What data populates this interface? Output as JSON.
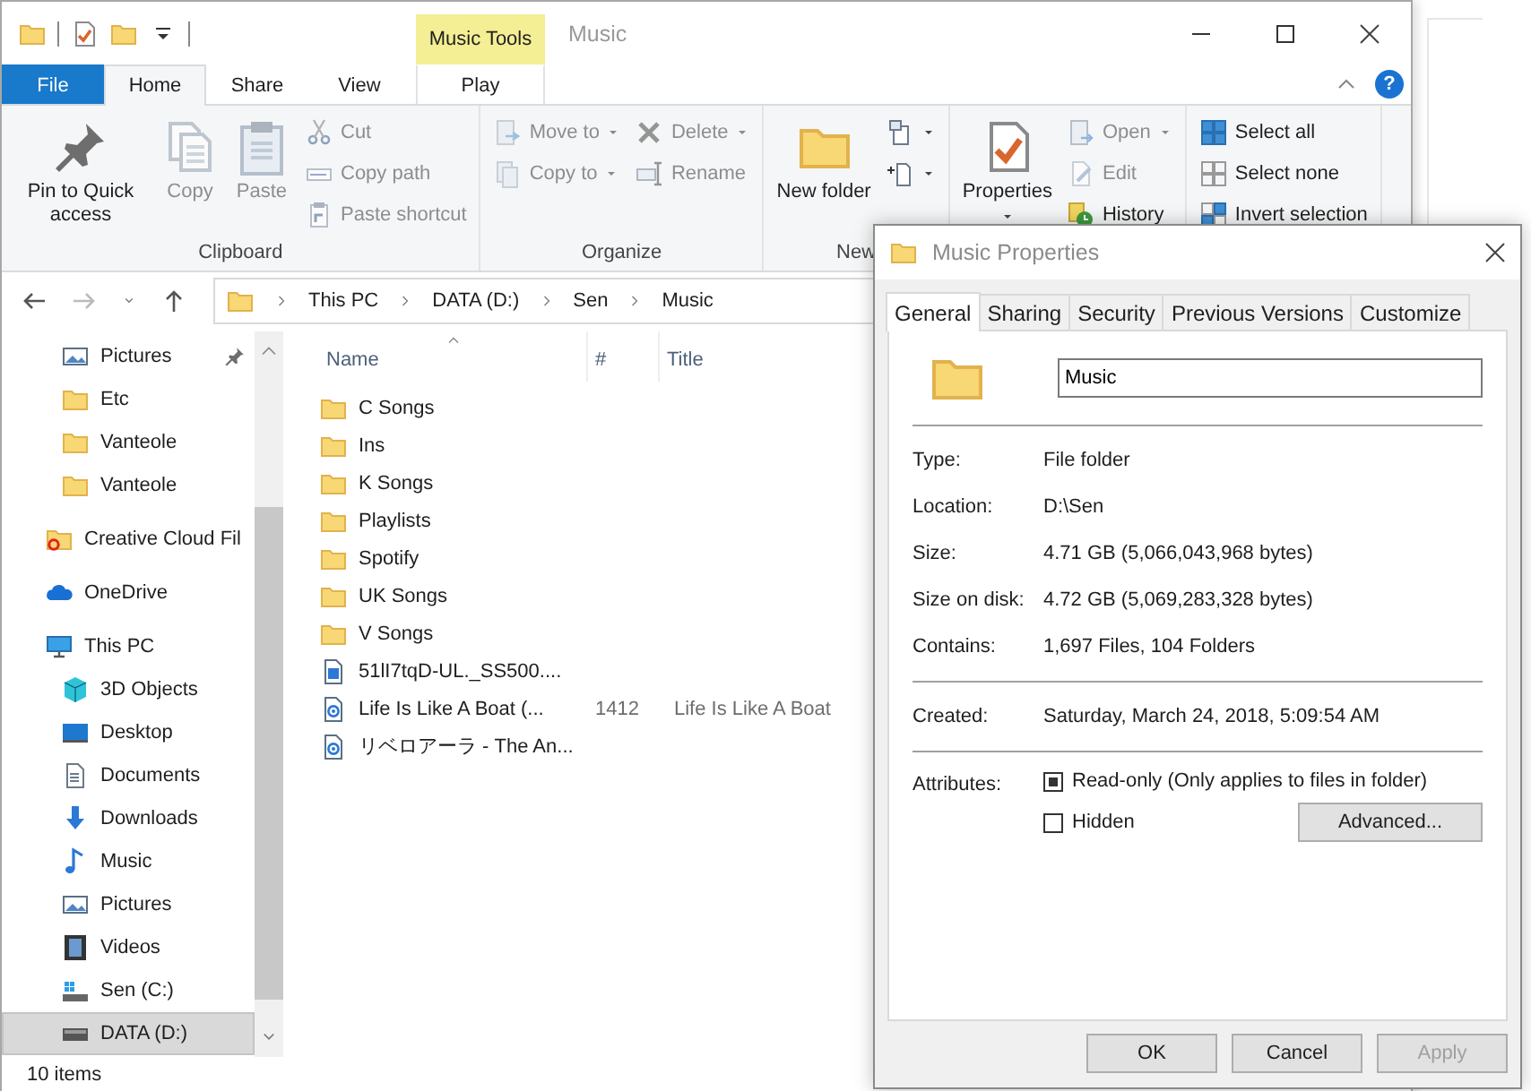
{
  "explorer": {
    "title": "Music",
    "contextual_tab": {
      "group": "Music Tools",
      "tab": {
        "label": "Play",
        "selected": false
      }
    },
    "ribbon_tabs": [
      {
        "label": "File",
        "kind": "file",
        "selected": false
      },
      {
        "label": "Home",
        "kind": "tab",
        "selected": true
      },
      {
        "label": "Share",
        "kind": "tab",
        "selected": false
      },
      {
        "label": "View",
        "kind": "tab",
        "selected": false
      }
    ],
    "help_button": "?",
    "ribbon_groups": [
      {
        "label": "Clipboard",
        "columns": [
          [
            {
              "label": "Pin to Quick access",
              "kind": "large",
              "disabled": false,
              "dropdown": false
            }
          ],
          [
            {
              "label": "Copy",
              "kind": "large",
              "disabled": true,
              "dropdown": false
            }
          ],
          [
            {
              "label": "Paste",
              "kind": "large",
              "disabled": true,
              "dropdown": false
            }
          ],
          [
            {
              "label": "Cut",
              "kind": "small",
              "disabled": true,
              "dropdown": false
            },
            {
              "label": "Copy path",
              "kind": "small",
              "disabled": true,
              "dropdown": false
            },
            {
              "label": "Paste shortcut",
              "kind": "small",
              "disabled": true,
              "dropdown": false
            }
          ]
        ]
      },
      {
        "label": "Organize",
        "columns": [
          [
            {
              "label": "Move to",
              "kind": "small",
              "disabled": true,
              "dropdown": true
            },
            {
              "label": "Copy to",
              "kind": "small",
              "disabled": true,
              "dropdown": true
            }
          ],
          [
            {
              "label": "Delete",
              "kind": "small",
              "disabled": true,
              "dropdown": true
            },
            {
              "label": "Rename",
              "kind": "small",
              "disabled": true,
              "dropdown": false
            }
          ]
        ]
      },
      {
        "label": "New",
        "columns": [
          [
            {
              "label": "New folder",
              "kind": "large",
              "disabled": false,
              "dropdown": false
            }
          ],
          [
            {
              "kind": "small",
              "disabled": false,
              "dropdown": true
            },
            {
              "kind": "small",
              "disabled": false,
              "dropdown": true
            }
          ]
        ]
      },
      {
        "columns": [
          [
            {
              "label": "Properties",
              "kind": "large",
              "disabled": false,
              "dropdown": true
            }
          ],
          [
            {
              "label": "Open",
              "kind": "small",
              "disabled": true,
              "dropdown": true
            },
            {
              "label": "Edit",
              "kind": "small",
              "disabled": true,
              "dropdown": false
            },
            {
              "label": "History",
              "kind": "small",
              "disabled": false,
              "dropdown": false
            }
          ]
        ]
      },
      {
        "columns": [
          [
            {
              "label": "Select all",
              "kind": "small",
              "disabled": false,
              "dropdown": false
            },
            {
              "label": "Select none",
              "kind": "small",
              "disabled": false,
              "dropdown": false
            },
            {
              "label": "Invert selection",
              "kind": "small",
              "disabled": false,
              "dropdown": false
            }
          ]
        ]
      }
    ],
    "address": [
      "This PC",
      "DATA (D:)",
      "Sen",
      "Music"
    ],
    "navigation": [
      {
        "children": [
          {
            "label": "Pictures",
            "pinned": true,
            "selected": false
          },
          {
            "label": "Etc",
            "pinned": false,
            "selected": false
          },
          {
            "label": "Vanteole",
            "pinned": false,
            "selected": false
          },
          {
            "label": "Vanteole",
            "pinned": false,
            "selected": false
          }
        ]
      },
      {
        "label": "Creative Cloud Fil",
        "selected": false
      },
      {
        "label": "OneDrive",
        "selected": false
      },
      {
        "label": "This PC",
        "selected": false,
        "children": [
          {
            "label": "3D Objects",
            "pinned": false,
            "selected": false
          },
          {
            "label": "Desktop",
            "pinned": false,
            "selected": false
          },
          {
            "label": "Documents",
            "pinned": false,
            "selected": false
          },
          {
            "label": "Downloads",
            "pinned": false,
            "selected": false
          },
          {
            "label": "Music",
            "pinned": false,
            "selected": false
          },
          {
            "label": "Pictures",
            "pinned": false,
            "selected": false
          },
          {
            "label": "Videos",
            "pinned": false,
            "selected": false
          },
          {
            "label": "Sen (C:)",
            "pinned": false,
            "selected": false
          },
          {
            "label": "DATA (D:)",
            "pinned": false,
            "selected": true
          }
        ]
      }
    ],
    "columns": [
      {
        "label": "Name",
        "sorted": true
      },
      {
        "label": "#",
        "sorted": false
      },
      {
        "label": "Title",
        "sorted": false
      }
    ],
    "files": [
      {
        "name": "C Songs",
        "kind": "folder"
      },
      {
        "name": "Ins",
        "kind": "folder"
      },
      {
        "name": "K Songs",
        "kind": "folder"
      },
      {
        "name": "Playlists",
        "kind": "folder"
      },
      {
        "name": "Spotify",
        "kind": "folder"
      },
      {
        "name": "UK Songs",
        "kind": "folder"
      },
      {
        "name": "V Songs",
        "kind": "folder"
      },
      {
        "name": "51lI7tqD-UL._SS500....",
        "kind": "image"
      },
      {
        "name": "Life Is Like A Boat (...",
        "kind": "audio",
        "number": "1412",
        "title": "Life Is Like A Boat"
      },
      {
        "name": "リベロアーラ - The An...",
        "kind": "audio"
      }
    ],
    "status": "10 items"
  },
  "dialog": {
    "title": "Music Properties",
    "tabs": [
      {
        "label": "General",
        "selected": true
      },
      {
        "label": "Sharing",
        "selected": false
      },
      {
        "label": "Security",
        "selected": false
      },
      {
        "label": "Previous Versions",
        "selected": false
      },
      {
        "label": "Customize",
        "selected": false
      }
    ],
    "name_value": "Music",
    "sections": [
      [
        {
          "label": "Type:",
          "value": "File folder"
        },
        {
          "label": "Location:",
          "value": "D:\\Sen"
        },
        {
          "label": "Size:",
          "value": "4.71 GB (5,066,043,968 bytes)"
        },
        {
          "label": "Size on disk:",
          "value": "4.72 GB (5,069,283,328 bytes)"
        },
        {
          "label": "Contains:",
          "value": "1,697 Files, 104 Folders"
        }
      ],
      [
        {
          "label": "Created:",
          "value": "Saturday, March 24, 2018, 5:09:54 AM"
        }
      ]
    ],
    "attributes_label": "Attributes:",
    "attributes": [
      {
        "label": "Read-only (Only applies to files in folder)",
        "checked": false,
        "mixed": true
      },
      {
        "label": "Hidden",
        "checked": false,
        "mixed": false
      }
    ],
    "advanced_button": "Advanced...",
    "buttons": [
      {
        "label": "OK",
        "disabled": false
      },
      {
        "label": "Cancel",
        "disabled": false
      },
      {
        "label": "Apply",
        "disabled": true
      }
    ]
  }
}
